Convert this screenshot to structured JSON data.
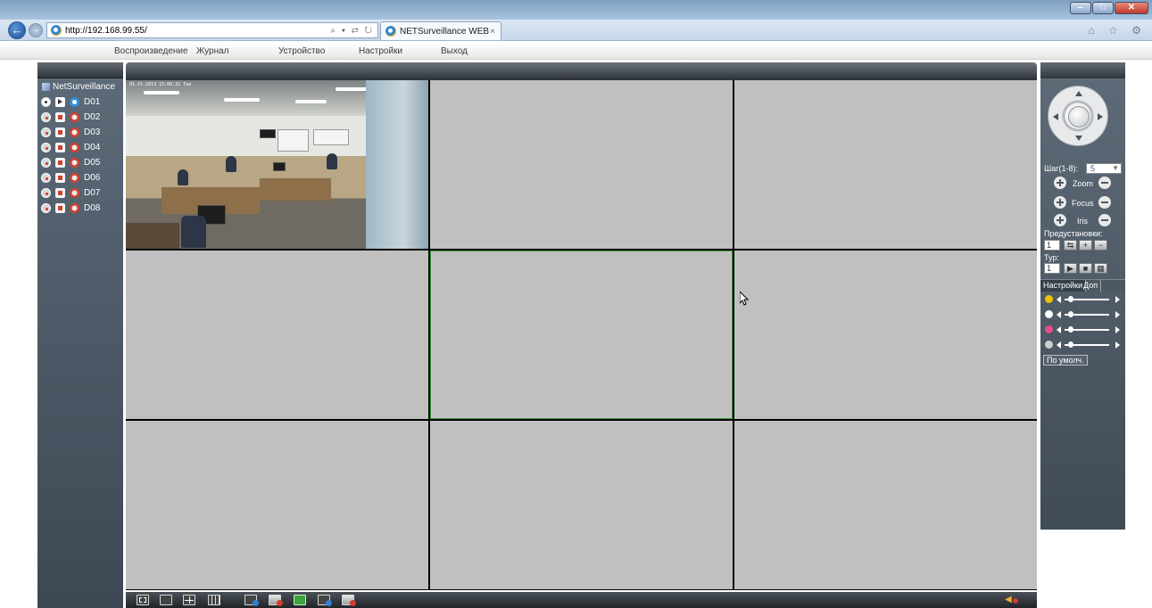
{
  "browser": {
    "url": "http://192.168.99.55/",
    "url_tools": "⌕ ▾ ⇄ ↻",
    "tab_title": "NETSurveillance WEB",
    "tab_close": "×",
    "back": "←",
    "forward": "→",
    "home_star_gear": "⌂ ☆ ⚙",
    "win_min": "‒",
    "win_max": "□",
    "win_close": "✕"
  },
  "menu": {
    "items": [
      {
        "label": "Воспроизведение"
      },
      {
        "label": "Журнал"
      },
      {
        "label": "Устройство"
      },
      {
        "label": "Настройки"
      },
      {
        "label": "Выход"
      }
    ]
  },
  "device_tree": {
    "root": "NetSurveillance",
    "channels": [
      {
        "name": "D01",
        "playing": true
      },
      {
        "name": "D02",
        "playing": false
      },
      {
        "name": "D03",
        "playing": false
      },
      {
        "name": "D04",
        "playing": false
      },
      {
        "name": "D05",
        "playing": false
      },
      {
        "name": "D06",
        "playing": false
      },
      {
        "name": "D07",
        "playing": false
      },
      {
        "name": "D08",
        "playing": false
      }
    ]
  },
  "video": {
    "layout": "3x3",
    "active_cell": 5,
    "live_cell": 1,
    "osd_text": "01-15-2013 15:06:32 Tue"
  },
  "ptz": {
    "step_label": "Шаг(1-8):",
    "step_value": "5",
    "zoom_label": "Zoom",
    "focus_label": "Focus",
    "iris_label": "Iris",
    "presets_label": "Предустановки:",
    "preset_value": "1",
    "tour_label": "Тур:",
    "tour_value": "1"
  },
  "image_settings": {
    "tabs": [
      "Настройки",
      "Доп"
    ],
    "sliders": [
      {
        "icon": "brightness-icon",
        "color": "#f2c200",
        "level": 0.1
      },
      {
        "icon": "contrast-icon",
        "color": "#ffffff",
        "level": 0.1
      },
      {
        "icon": "saturation-icon",
        "color": "#e0508f",
        "level": 0.1
      },
      {
        "icon": "hue-icon",
        "color": "#cfcfcf",
        "level": 0.1
      }
    ],
    "default_button": "По умолч."
  },
  "colors": {
    "active_cell_border": "#3a9c3a",
    "panel": "#4b5661"
  }
}
